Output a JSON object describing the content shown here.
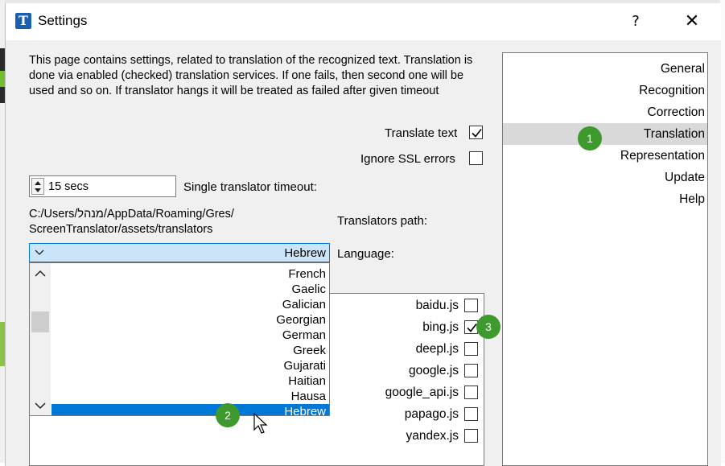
{
  "window": {
    "title": "Settings",
    "app_icon_letter": "T",
    "help_label": "?",
    "close_label": "✕"
  },
  "description": "This page contains settings, related to translation of the recognized text. Translation is done via enabled (checked) translation services. If one fails, then second one will be used and so on. If translator hangs it will be treated as failed after given timeout",
  "translate_text": {
    "label": "Translate text",
    "checked": true
  },
  "ignore_ssl": {
    "label": "Ignore SSL errors",
    "checked": false
  },
  "timeout": {
    "value": "15 secs",
    "label": "Single translator timeout:"
  },
  "translators_path": {
    "line1": "C:/Users/מנהל/AppData/Roaming/Gres/",
    "line2": "ScreenTranslator/assets/translators",
    "label": "Translators path:"
  },
  "language": {
    "label": "Language:",
    "selected": "Hebrew",
    "options": [
      "French",
      "Gaelic",
      "Galician",
      "Georgian",
      "German",
      "Greek",
      "Gujarati",
      "Haitian",
      "Hausa",
      "Hebrew"
    ]
  },
  "translators": [
    {
      "name": "baidu.js",
      "checked": false
    },
    {
      "name": "bing.js",
      "checked": true
    },
    {
      "name": "deepl.js",
      "checked": false
    },
    {
      "name": "google.js",
      "checked": false
    },
    {
      "name": "google_api.js",
      "checked": false
    },
    {
      "name": "papago.js",
      "checked": false
    },
    {
      "name": "yandex.js",
      "checked": false
    }
  ],
  "sidebar": {
    "items": [
      {
        "label": "General"
      },
      {
        "label": "Recognition"
      },
      {
        "label": "Correction"
      },
      {
        "label": "Translation"
      },
      {
        "label": "Representation"
      },
      {
        "label": "Update"
      },
      {
        "label": "Help"
      }
    ],
    "selected": "Translation"
  },
  "badges": {
    "b1": "1",
    "b2": "2",
    "b3": "3"
  },
  "colors": {
    "accent": "#0078d7",
    "badge": "#3e9a2c",
    "selected_item": "#d9d9d9"
  }
}
